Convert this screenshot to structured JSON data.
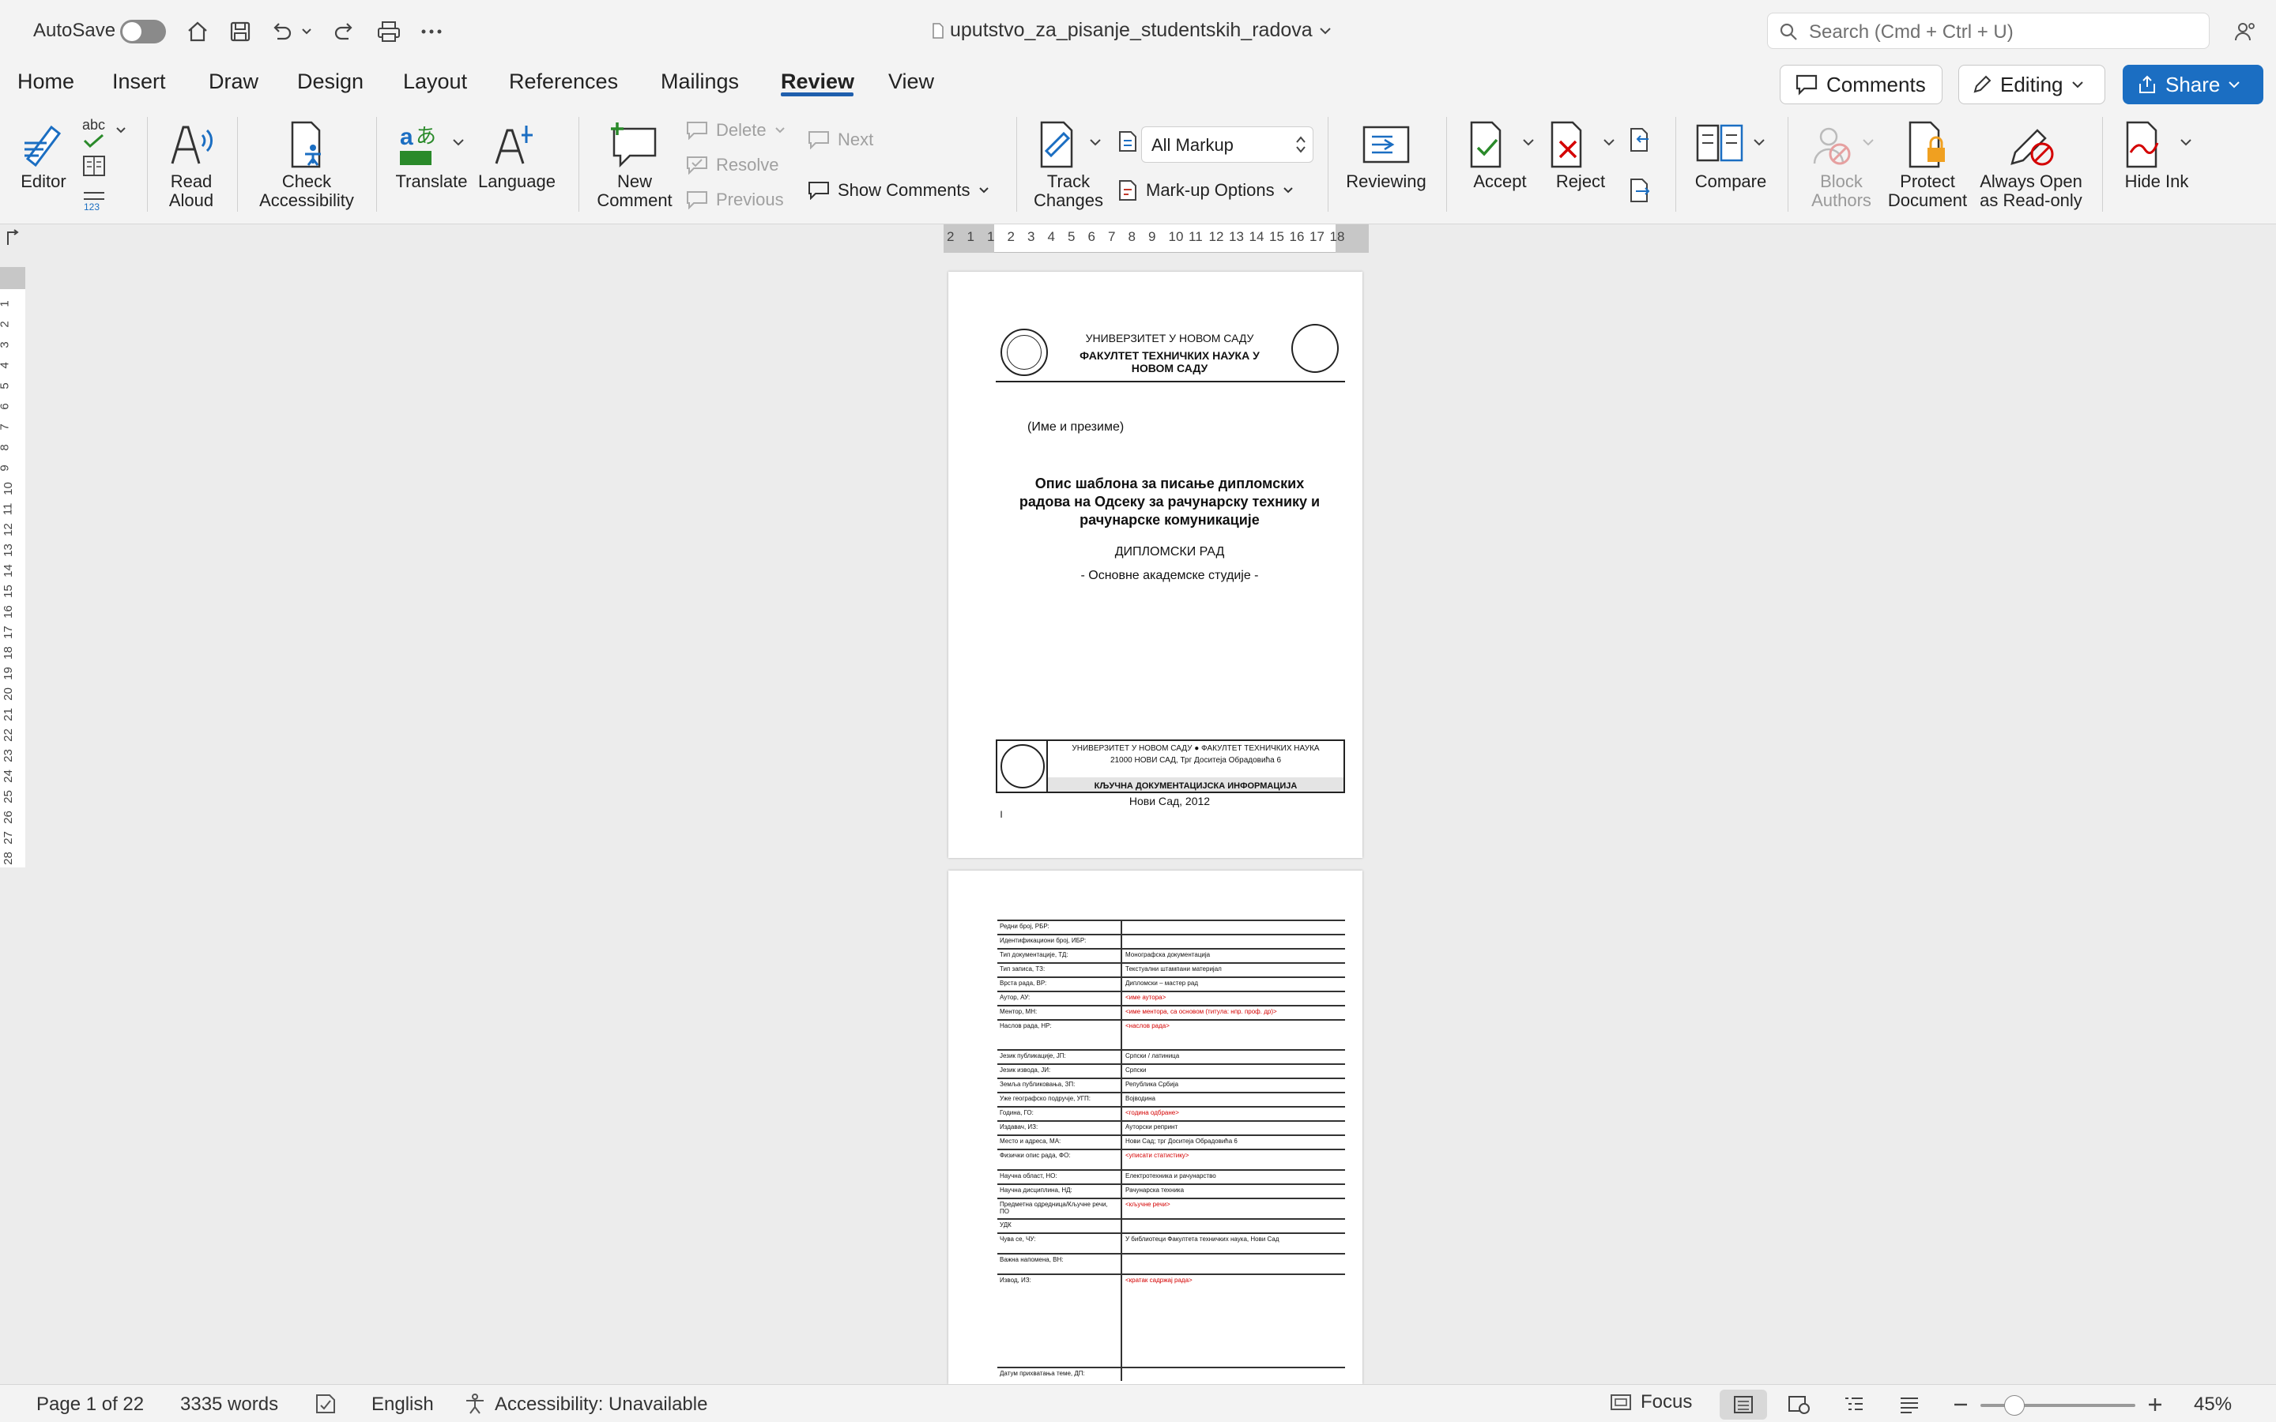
{
  "titlebar": {
    "autosave_label": "AutoSave",
    "doc_title": "uputstvo_za_pisanje_studentskih_radova",
    "search_placeholder": "Search (Cmd + Ctrl + U)"
  },
  "tabs": [
    "Home",
    "Insert",
    "Draw",
    "Design",
    "Layout",
    "References",
    "Mailings",
    "Review",
    "View"
  ],
  "active_tab": "Review",
  "header_buttons": {
    "comments": "Comments",
    "editing": "Editing",
    "share": "Share"
  },
  "ribbon": {
    "editor": "Editor",
    "read_aloud": [
      "Read",
      "Aloud"
    ],
    "check_accessibility": [
      "Check",
      "Accessibility"
    ],
    "translate": "Translate",
    "language": "Language",
    "new_comment": [
      "New",
      "Comment"
    ],
    "delete": "Delete",
    "resolve": "Resolve",
    "previous": "Previous",
    "next": "Next",
    "show_comments": "Show Comments",
    "track_changes": [
      "Track",
      "Changes"
    ],
    "markup_dropdown": "All Markup",
    "markup_options": "Mark-up Options",
    "reviewing": "Reviewing",
    "accept": "Accept",
    "reject": "Reject",
    "compare": "Compare",
    "block_authors": [
      "Block",
      "Authors"
    ],
    "protect_document": [
      "Protect",
      "Document"
    ],
    "always_open": [
      "Always Open",
      "as Read-only"
    ],
    "hide_ink": "Hide Ink",
    "spell_abc": "abc"
  },
  "page1": {
    "univ_line1": "УНИВЕРЗИТЕТ У НОВОМ САДУ",
    "univ_line2": "ФАКУЛТЕТ ТЕХНИЧКИХ НАУКА У",
    "univ_line3": "НОВОМ САДУ",
    "author": "(Име и презиме)",
    "title_line1": "Опис шаблона за писање дипломских",
    "title_line2": "радова на Одсеку за рачунарску технику и",
    "title_line3": "рачунарске комуникације",
    "thesis_type": "ДИПЛОМСКИ РАД",
    "study_level": "- Основне академске студије -",
    "box_line1": "УНИВЕРЗИТЕТ У НОВОМ САДУ ● ФАКУЛТЕТ ТЕХНИЧКИХ НАУКА",
    "box_line2": "21000 НОВИ САД, Трг Доситеја Обрадовића 6",
    "box_line3": "КЉУЧНА ДОКУМЕНТАЦИЈСКА ИНФОРМАЦИЈА",
    "place_date": "Нови Сад, 2012",
    "page_marker": "I"
  },
  "page2_rows": [
    {
      "k": "Редни број, РБР:",
      "v": "",
      "red": false
    },
    {
      "k": "Идентификациони број, ИБР:",
      "v": "",
      "red": false
    },
    {
      "k": "Тип документације, ТД:",
      "v": "Монографска документација",
      "red": false
    },
    {
      "k": "Тип записа, ТЗ:",
      "v": "Текстуални штампани материјал",
      "red": false
    },
    {
      "k": "Врста рада, ВР:",
      "v": "Дипломски – мастер рад",
      "red": false
    },
    {
      "k": "Аутор, АУ:",
      "v": "<име аутора>",
      "red": true
    },
    {
      "k": "Ментор, МН:",
      "v": "<име ментора, са основом (титула: нпр. проф. др)>",
      "red": true
    },
    {
      "k": "Наслов рада, НР:",
      "v": "<наслов рада>",
      "red": true,
      "tall": true
    },
    {
      "k": "Језик публикације, ЈП:",
      "v": "Српски / латиница",
      "red": false
    },
    {
      "k": "Језик извода, ЈИ:",
      "v": "Српски",
      "red": false
    },
    {
      "k": "Земља публиковања, ЗП:",
      "v": "Република Србија",
      "red": false
    },
    {
      "k": "Уже географско подручје, УГП:",
      "v": "Војводина",
      "red": false
    },
    {
      "k": "Година, ГО:",
      "v": "<година одбране>",
      "red": true
    },
    {
      "k": "Издавач, ИЗ:",
      "v": "Ауторски репринт",
      "red": false
    },
    {
      "k": "Место и адреса, МА:",
      "v": "Нови Сад; трг Доситеја Обрадовића 6",
      "red": false
    },
    {
      "k": "Физички опис рада, ФО:",
      "v": "<уписати статистику>",
      "red": true,
      "mid": true
    },
    {
      "k": "Научна област, НО:",
      "v": "Електротехника и рачунарство",
      "red": false
    },
    {
      "k": "Научна дисциплина, НД:",
      "v": "Рачунарска техника",
      "red": false
    },
    {
      "k": "Предметна одредница/Кључне речи, ПО",
      "v": "<кључне речи>",
      "red": true,
      "mid": true
    },
    {
      "k": "УДК",
      "v": "",
      "red": false
    },
    {
      "k": "Чува се, ЧУ:",
      "v": "У библиотеци Факултета техничких наука, Нови Сад",
      "red": false,
      "mid": true
    },
    {
      "k": "Важна напомена, ВН:",
      "v": "",
      "red": false,
      "mid": true
    },
    {
      "k": "Извод, ИЗ:",
      "v": "<кратак садржај рада>",
      "red": true,
      "huge": true
    },
    {
      "k": "Датум прихватања теме, ДП:",
      "v": "",
      "red": false
    }
  ],
  "ruler_numbers": [
    "2",
    "1",
    "1",
    "2",
    "3",
    "4",
    "5",
    "6",
    "7",
    "8",
    "9",
    "10",
    "11",
    "12",
    "13",
    "14",
    "15",
    "16",
    "17",
    "18"
  ],
  "vruler_numbers": [
    "1",
    "2",
    "3",
    "4",
    "5",
    "6",
    "7",
    "8",
    "9",
    "10",
    "11",
    "12",
    "13",
    "14",
    "15",
    "16",
    "17",
    "18",
    "19",
    "20",
    "21",
    "22",
    "23",
    "24",
    "25",
    "26",
    "27",
    "28"
  ],
  "status": {
    "page": "Page 1 of 22",
    "words": "3335 words",
    "language": "English",
    "accessibility": "Accessibility: Unavailable",
    "focus": "Focus",
    "zoom": "45%"
  },
  "colors": {
    "accent": "#1b6ec2",
    "red_text": "#d40000"
  }
}
